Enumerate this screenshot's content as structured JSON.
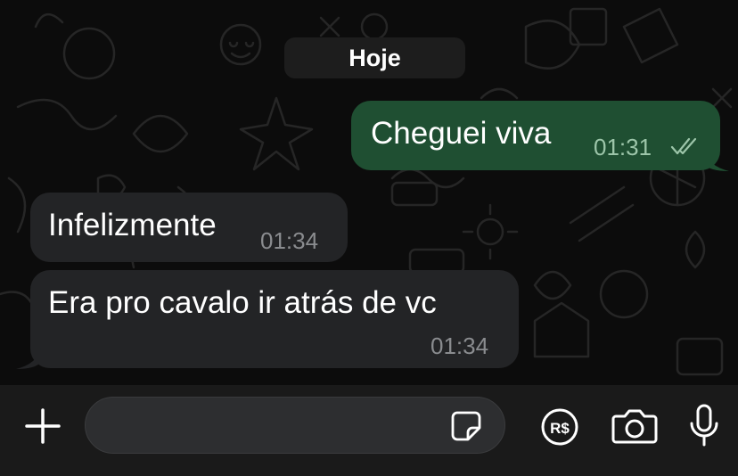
{
  "chat": {
    "date_label": "Hoje",
    "messages": [
      {
        "direction": "outgoing",
        "text": "Cheguei viva",
        "time": "01:31",
        "status": "read-double-check"
      },
      {
        "direction": "incoming",
        "text": "Infelizmente",
        "time": "01:34"
      },
      {
        "direction": "incoming",
        "text": "Era pro cavalo ir atrás de vc",
        "time": "01:34"
      }
    ]
  },
  "composer": {
    "input_value": "",
    "input_placeholder": "",
    "icons": [
      "plus-icon",
      "sticker-icon",
      "payment-reais-icon",
      "camera-icon",
      "microphone-icon"
    ],
    "payment_label": "R$"
  },
  "colors": {
    "outgoing_bubble": "#1f4f32",
    "incoming_bubble": "#232426",
    "background": "#0c0c0c",
    "composer_bar": "#1a1a1a"
  }
}
